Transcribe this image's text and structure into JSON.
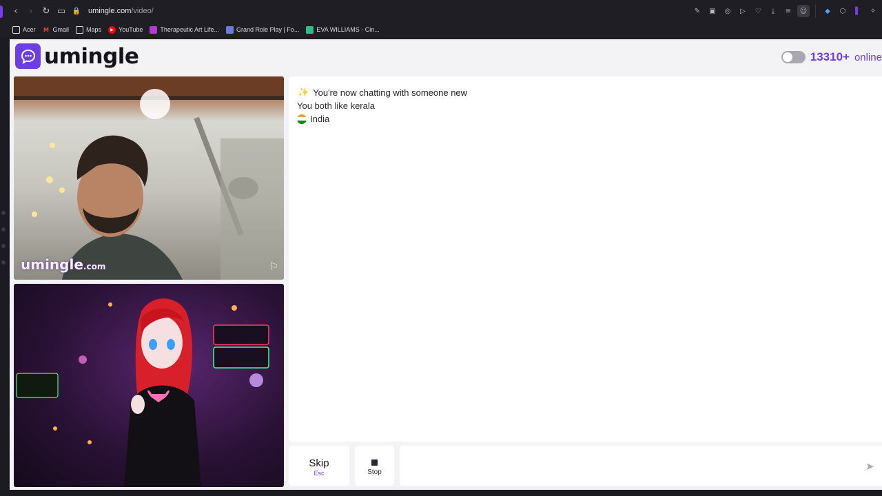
{
  "browser": {
    "url_host": "umingle.com",
    "url_path": "/video/",
    "bookmarks": [
      {
        "label": "Acer",
        "icon": "folder-icon",
        "color": "#dcdae2"
      },
      {
        "label": "Gmail",
        "icon": "gmail-icon",
        "color": "#ea4335"
      },
      {
        "label": "Maps",
        "icon": "maps-icon",
        "color": "#dcdae2"
      },
      {
        "label": "YouTube",
        "icon": "youtube-icon",
        "color": "#ff0000"
      },
      {
        "label": "Therapeutic Art Life...",
        "icon": "instagram-icon",
        "color": "#b13bd0"
      },
      {
        "label": "Grand Role Play | Fo...",
        "icon": "site-icon",
        "color": "#6a7bd8"
      },
      {
        "label": "EVA WILLIAMS - Cin...",
        "icon": "site-icon",
        "color": "#2bbd8a"
      }
    ]
  },
  "header": {
    "logo_text": "umingle",
    "online_count": "13310+",
    "online_label": "online"
  },
  "video": {
    "watermark": "umingle",
    "watermark_domain": ".com"
  },
  "chat": {
    "line1": "You're now chatting with someone new",
    "line2": "You both like kerala",
    "line3": "India"
  },
  "controls": {
    "skip_label": "Skip",
    "skip_key": "Esc",
    "stop_label": "Stop",
    "input_value": "",
    "input_placeholder": ""
  },
  "colors": {
    "accent": "#6d3fe0"
  }
}
